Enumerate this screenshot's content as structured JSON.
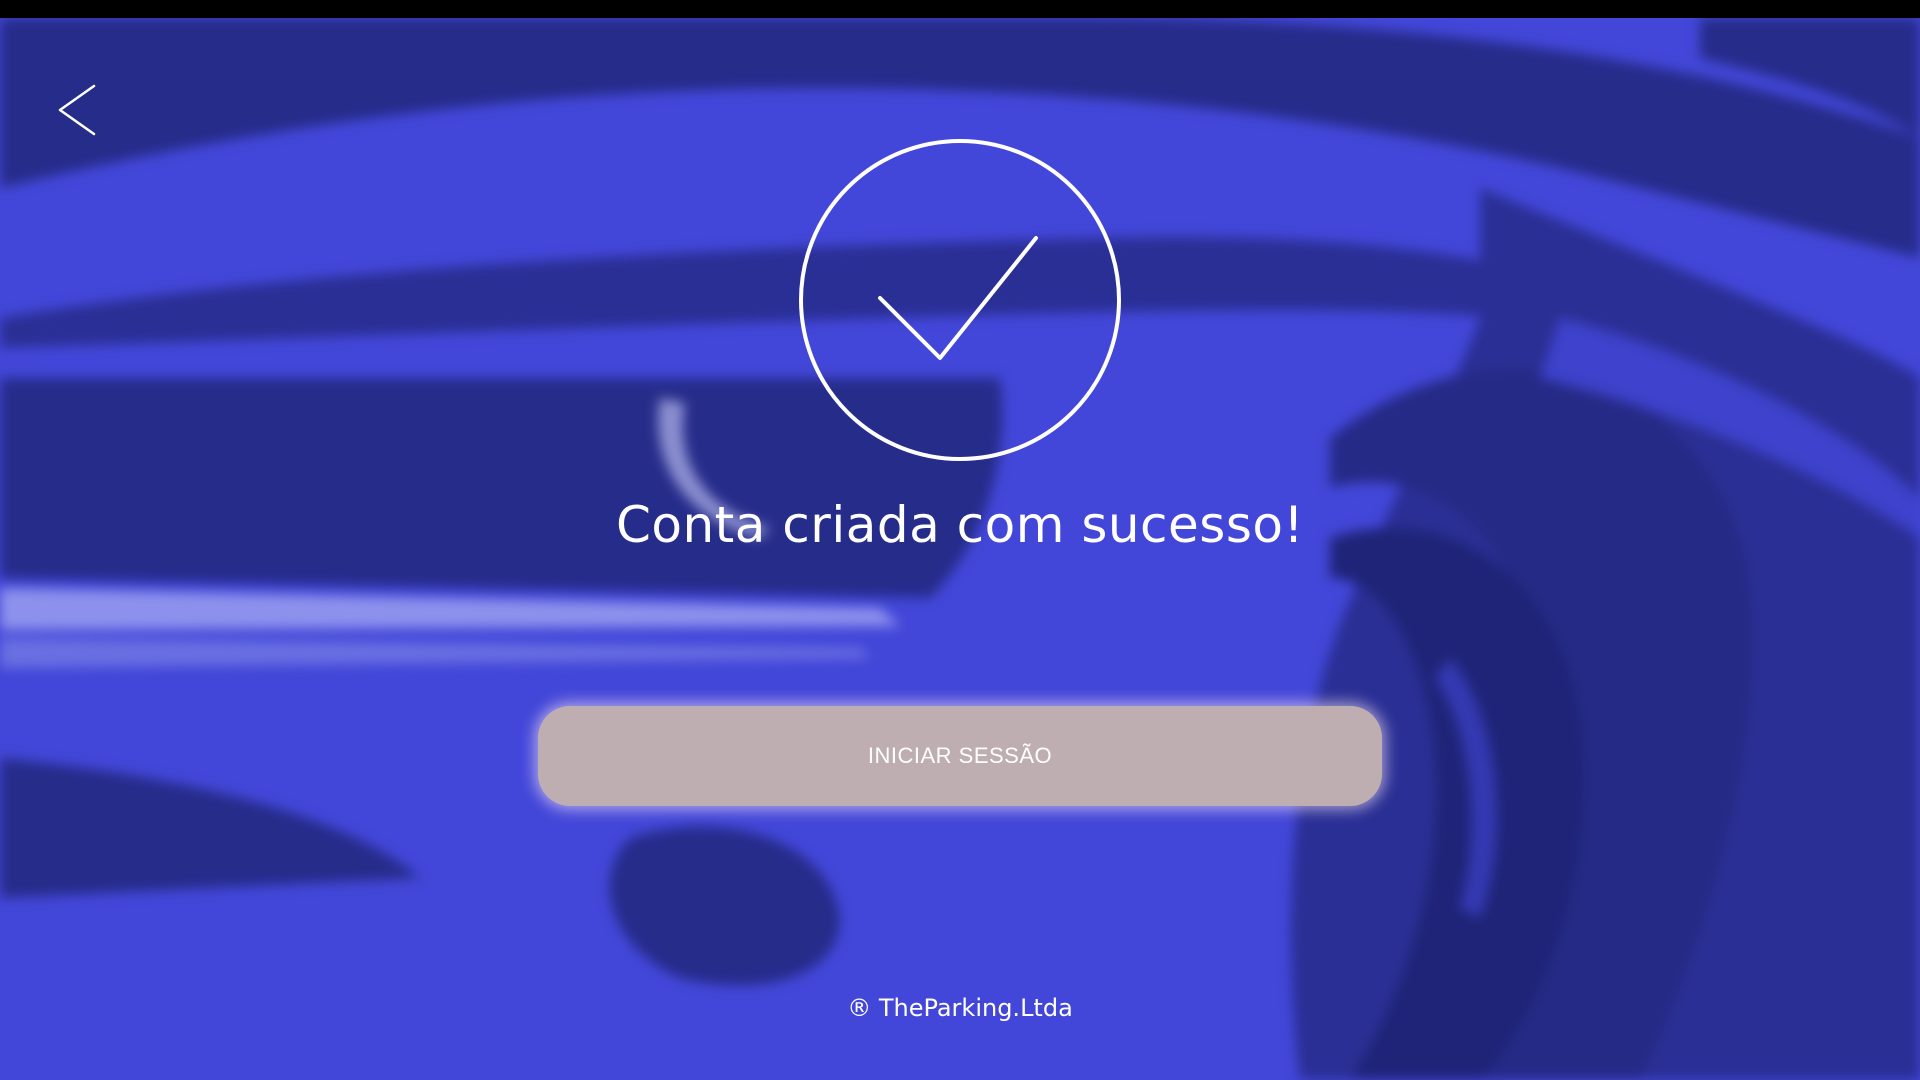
{
  "screen": {
    "title": "Conta criada com sucesso!",
    "button_label": "INICIAR SESSÃO",
    "footer": "® TheParking.Ltda"
  },
  "icons": {
    "back": "chevron-left-icon",
    "success": "check-circle-icon"
  },
  "colors": {
    "background": "#4347d9",
    "background_shadow": "#262c8a",
    "button": "#bfaeb1",
    "text": "#ffffff"
  }
}
